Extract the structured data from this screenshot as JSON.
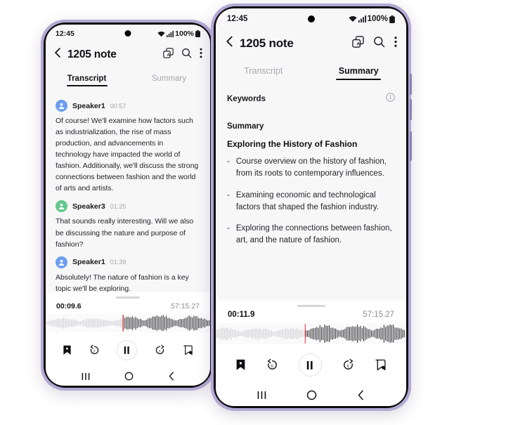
{
  "phones": {
    "left": {
      "status": {
        "time": "12:45",
        "battery": "100%",
        "wifi_icon": "wifi-icon",
        "signal_icon": "signal-icon",
        "battery_icon": "battery-icon"
      },
      "appbar": {
        "back_icon": "back-chevron-icon",
        "title": "1205 note",
        "translate_icon": "translate-icon",
        "search_icon": "search-icon",
        "more_icon": "more-vertical-icon"
      },
      "tabs": [
        {
          "label": "Transcript",
          "active": true
        },
        {
          "label": "Summary",
          "active": false
        }
      ],
      "transcript": [
        {
          "speaker": "Speaker1",
          "time": "00:57",
          "avatar_color": "#6c9ef0",
          "text": "Of course! We'll examine how factors such as industrialization, the rise of mass production, and advancements in technology have impacted the world of fashion. Additionally, we'll discuss the strong connections between fashion and the world of arts and artists."
        },
        {
          "speaker": "Speaker3",
          "time": "01:25",
          "avatar_color": "#63c98c",
          "text": "That sounds really interesting. Will we also be discussing the nature and purpose of fashion?"
        },
        {
          "speaker": "Speaker1",
          "time": "01:39",
          "avatar_color": "#6c9ef0",
          "text": "Absolutely! The nature of fashion is a key topic we'll be exploring."
        }
      ],
      "player": {
        "current_time": "00:09.6",
        "total_time": "57:15.27",
        "playhead_percent": 47,
        "playhead_color": "#f4616b",
        "buttons": [
          {
            "name": "bookmark-button",
            "icon": "bookmark-icon"
          },
          {
            "name": "rewind-5-button",
            "icon": "rewind-5-icon"
          },
          {
            "name": "pause-button",
            "icon": "pause-icon"
          },
          {
            "name": "forward-5-button",
            "icon": "forward-5-icon"
          },
          {
            "name": "add-note-button",
            "icon": "note-tag-icon"
          }
        ]
      },
      "navbar": [
        {
          "name": "recents-button",
          "icon": "recents-icon"
        },
        {
          "name": "home-button",
          "icon": "home-icon"
        },
        {
          "name": "back-button",
          "icon": "back-icon"
        }
      ]
    },
    "right": {
      "status": {
        "time": "12:45",
        "battery": "100%",
        "wifi_icon": "wifi-icon",
        "signal_icon": "signal-icon",
        "battery_icon": "battery-icon"
      },
      "appbar": {
        "back_icon": "back-chevron-icon",
        "title": "1205 note",
        "translate_icon": "translate-icon",
        "search_icon": "search-icon",
        "more_icon": "more-vertical-icon"
      },
      "tabs": [
        {
          "label": "Transcript",
          "active": false
        },
        {
          "label": "Summary",
          "active": true
        }
      ],
      "summary": {
        "keywords_label": "Keywords",
        "info_icon": "info-circle-icon",
        "summary_label": "Summary",
        "heading": "Exploring the History of Fashion",
        "bullet_marker": "-",
        "bullets": [
          "Course overview on the history of fashion, from its roots to contemporary influences.",
          "Examining economic and technological factors that shaped the fashion industry.",
          "Exploring the connections between fashion, art, and the nature of fashion."
        ]
      },
      "player": {
        "current_time": "00:11.9",
        "total_time": "57:15.27",
        "playhead_percent": 47,
        "playhead_color": "#f4616b",
        "buttons": [
          {
            "name": "bookmark-button",
            "icon": "bookmark-icon"
          },
          {
            "name": "rewind-5-button",
            "icon": "rewind-5-icon"
          },
          {
            "name": "pause-button",
            "icon": "pause-icon"
          },
          {
            "name": "forward-5-button",
            "icon": "forward-5-icon"
          },
          {
            "name": "add-note-button",
            "icon": "note-tag-icon"
          }
        ]
      },
      "navbar": [
        {
          "name": "recents-button",
          "icon": "recents-icon"
        },
        {
          "name": "home-button",
          "icon": "home-icon"
        },
        {
          "name": "back-button",
          "icon": "back-icon"
        }
      ]
    }
  },
  "colors": {
    "frame": "#b3a9d4",
    "bezel": "#0d0d10",
    "screen_bg": "#f7f7f8",
    "player_bg": "#ffffff",
    "accent_playhead": "#f4616b",
    "text_primary": "#17171b",
    "text_muted": "#a9a9ae"
  }
}
